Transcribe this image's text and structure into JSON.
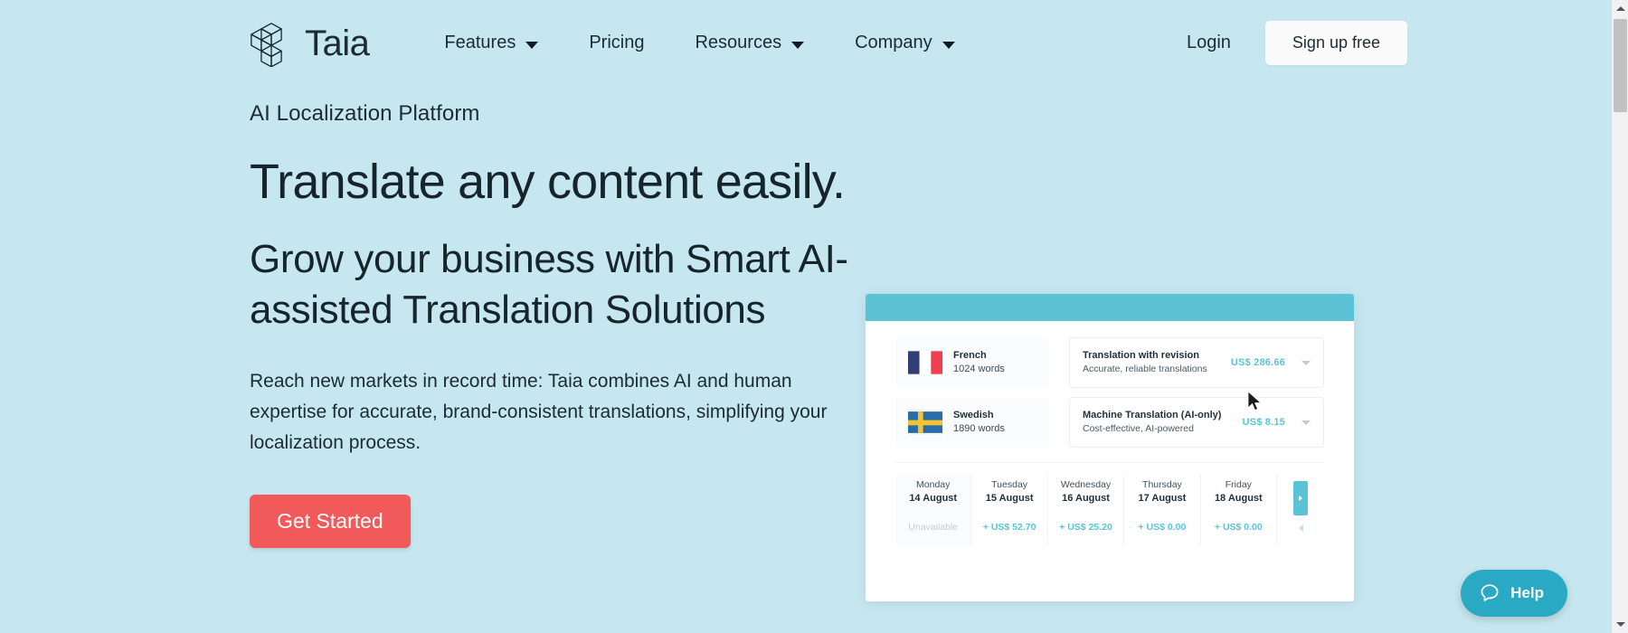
{
  "theme": {
    "page_bg": "#c6e7f0",
    "accent_teal": "#5cc3d7",
    "accent_red": "#f1595b",
    "help_teal": "#2aa9c4",
    "text_dark": "#16242c"
  },
  "navbar": {
    "brand_name": "Taia",
    "brand_logo_icon": "isometric-cubes-logo",
    "links": [
      {
        "label": "Features",
        "has_dropdown": true
      },
      {
        "label": "Pricing",
        "has_dropdown": false
      },
      {
        "label": "Resources",
        "has_dropdown": true
      },
      {
        "label": "Company",
        "has_dropdown": true
      }
    ],
    "login_label": "Login",
    "signup_label": "Sign up free"
  },
  "hero": {
    "eyebrow": "AI Localization Platform",
    "headline": "Translate any content easily.",
    "subheadline": "Grow your business with Smart AI-assisted Translation Solutions",
    "lede": "Reach new markets in record time: Taia combines AI and human expertise for accurate, brand-consistent translations, simplifying your localization process.",
    "cta_label": "Get Started"
  },
  "product_card": {
    "rows": [
      {
        "language": "French",
        "flag": "flag-france",
        "words": "1024 words",
        "service_title": "Translation with revision",
        "service_sub": "Accurate, reliable translations",
        "price": "US$ 286.66"
      },
      {
        "language": "Swedish",
        "flag": "flag-sweden",
        "words": "1890 words",
        "service_title": "Machine Translation (AI-only)",
        "service_sub": "Cost-effective, AI-powered",
        "price": "US$ 8.15"
      }
    ],
    "dates": [
      {
        "day": "Monday",
        "date": "14 August",
        "price": "Unavailable",
        "available": false
      },
      {
        "day": "Tuesday",
        "date": "15 August",
        "price": "+ US$ 52.70",
        "available": true
      },
      {
        "day": "Wednesday",
        "date": "16 August",
        "price": "+ US$ 25.20",
        "available": true
      },
      {
        "day": "Thursday",
        "date": "17 August",
        "price": "+ US$ 0.00",
        "available": true
      },
      {
        "day": "Friday",
        "date": "18 August",
        "price": "+ US$ 0.00",
        "available": true
      }
    ],
    "next_icon": "chevron-right-icon",
    "cursor_icon": "mouse-pointer-icon"
  },
  "help_widget": {
    "label": "Help",
    "icon": "speech-bubble-icon"
  },
  "scrollbar": {
    "up_icon": "scroll-up-arrow-icon",
    "down_icon": "scroll-down-arrow-icon",
    "thumb": "scroll-thumb"
  }
}
